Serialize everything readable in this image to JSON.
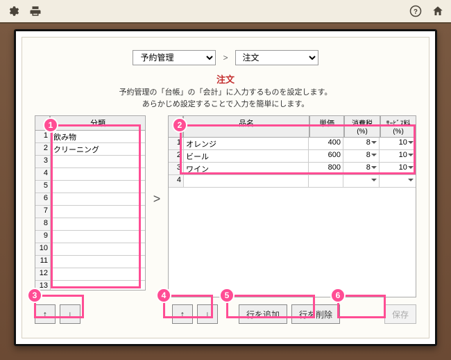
{
  "topbar": {
    "icons": {
      "settings": "gear-icon",
      "print": "print-icon",
      "help": "help-icon",
      "home": "home-icon"
    }
  },
  "breadcrumb": {
    "level1_selected": "予約管理",
    "level1_options": [
      "予約管理"
    ],
    "sep": ">",
    "level2_selected": "注文",
    "level2_options": [
      "注文"
    ]
  },
  "page": {
    "title": "注文",
    "desc_line1": "予約管理の「台帳」の「会計」に入力するものを設定します。",
    "desc_line2": "あらかじめ設定することで入力を簡単にします。"
  },
  "left_grid": {
    "header_category": "分類",
    "rows": [
      {
        "n": 1,
        "label": "飲み物"
      },
      {
        "n": 2,
        "label": "クリーニング"
      },
      {
        "n": 3,
        "label": ""
      },
      {
        "n": 4,
        "label": ""
      },
      {
        "n": 5,
        "label": ""
      },
      {
        "n": 6,
        "label": ""
      },
      {
        "n": 7,
        "label": ""
      },
      {
        "n": 8,
        "label": ""
      },
      {
        "n": 9,
        "label": ""
      },
      {
        "n": 10,
        "label": ""
      },
      {
        "n": 11,
        "label": ""
      },
      {
        "n": 12,
        "label": ""
      },
      {
        "n": 13,
        "label": ""
      }
    ]
  },
  "mid_arrow": ">",
  "right_grid": {
    "header_name": "品名",
    "header_price": "単価",
    "header_tax": "消費税(%)",
    "header_service": "ｻｰﾋﾞｽ料(%)",
    "rows": [
      {
        "n": 1,
        "name": "オレンジ",
        "price": "400",
        "tax": "8",
        "svc": "10"
      },
      {
        "n": 2,
        "name": "ビール",
        "price": "600",
        "tax": "8",
        "svc": "10"
      },
      {
        "n": 3,
        "name": "ワイン",
        "price": "800",
        "tax": "8",
        "svc": "10"
      },
      {
        "n": 4,
        "name": "",
        "price": "",
        "tax": "",
        "svc": ""
      }
    ]
  },
  "buttons": {
    "up": "↑",
    "down": "↓",
    "add_row": "行を追加",
    "del_row": "行を削除",
    "save": "保存"
  },
  "annotations": [
    {
      "num": "1"
    },
    {
      "num": "2"
    },
    {
      "num": "3"
    },
    {
      "num": "4"
    },
    {
      "num": "5"
    },
    {
      "num": "6"
    }
  ],
  "colors": {
    "accent_annotation": "#ff4d94",
    "title_red": "#c42e2e"
  }
}
